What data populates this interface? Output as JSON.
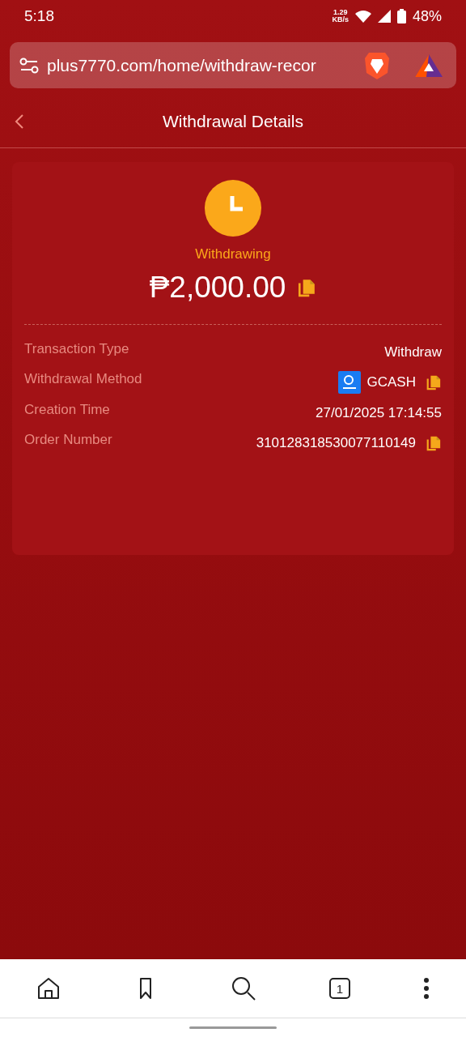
{
  "status_bar": {
    "time": "5:18",
    "speed_value": "1.29",
    "speed_unit": "KB/s",
    "battery": "48%"
  },
  "browser": {
    "url": "plus7770.com/home/withdraw-recor",
    "tab_count": "1"
  },
  "header": {
    "title": "Withdrawal Details"
  },
  "summary": {
    "status": "Withdrawing",
    "amount": "₱2,000.00",
    "copyable": true
  },
  "details": [
    {
      "label": "Transaction Type",
      "value": "Withdraw",
      "logo": false,
      "copyable": false
    },
    {
      "label": "Withdrawal Method",
      "value": "GCASH",
      "logo": true,
      "copyable": true
    },
    {
      "label": "Creation Time",
      "value": "27/01/2025 17:14:55",
      "logo": false,
      "copyable": false
    },
    {
      "label": "Order Number",
      "value": "310128318530077110149",
      "logo": false,
      "copyable": true
    }
  ]
}
